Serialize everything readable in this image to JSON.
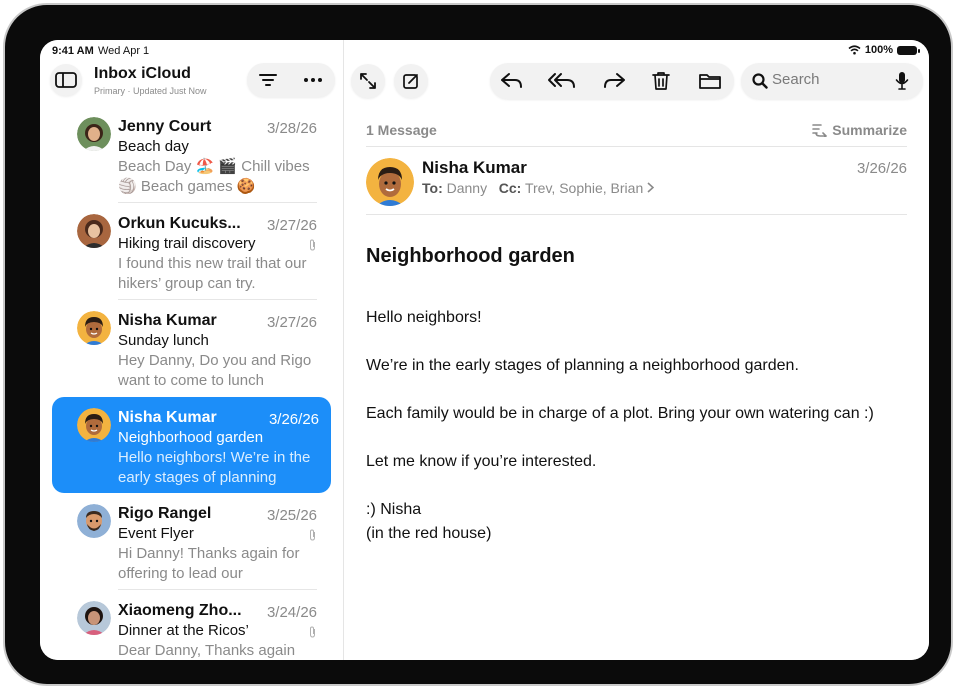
{
  "status": {
    "time": "9:41 AM",
    "date": "Wed Apr 1",
    "battery": "100%"
  },
  "mailbox": {
    "title": "Inbox iCloud",
    "subtitle": "Primary · Updated Just Now"
  },
  "toolbar": {
    "search_placeholder": "Search"
  },
  "messages": [
    {
      "sender": "Jenny Court",
      "date": "3/28/26",
      "subject": "Beach day",
      "preview": "Beach Day 🏖️ 🎬 Chill vibes 🏐 Beach games 🍪",
      "avatar": "jenny",
      "attachment": false
    },
    {
      "sender": "Orkun Kucuks...",
      "date": "3/27/26",
      "subject": "Hiking trail discovery",
      "preview": "I found this new trail that our hikers’ group can try.",
      "avatar": "orkun",
      "attachment": true
    },
    {
      "sender": "Nisha Kumar",
      "date": "3/27/26",
      "subject": "Sunday lunch",
      "preview": "Hey Danny, Do you and Rigo want to come to lunch",
      "avatar": "nisha",
      "attachment": false
    },
    {
      "sender": "Nisha Kumar",
      "date": "3/26/26",
      "subject": "Neighborhood garden",
      "preview": "Hello neighbors! We’re in the early stages of planning",
      "avatar": "nisha",
      "attachment": false,
      "selected": true
    },
    {
      "sender": "Rigo Rangel",
      "date": "3/25/26",
      "subject": "Event Flyer",
      "preview": "Hi Danny! Thanks again for offering to lead our",
      "avatar": "rigo",
      "attachment": true
    },
    {
      "sender": "Xiaomeng Zho...",
      "date": "3/24/26",
      "subject": "Dinner at the Ricos’",
      "preview": "Dear Danny, Thanks again",
      "avatar": "xiaomeng",
      "attachment": true
    }
  ],
  "detail": {
    "count_label": "1 Message",
    "summarize_label": "Summarize",
    "from": "Nisha Kumar",
    "to_label": "To:",
    "to": "Danny",
    "cc_label": "Cc:",
    "cc": "Trev, Sophie, Brian",
    "date": "3/26/26",
    "subject": "Neighborhood garden",
    "body": [
      "Hello neighbors!",
      "We’re in the early stages of planning a neighborhood garden.",
      "Each family would be in charge of a plot. Bring your own watering can :)",
      "Let me know if you’re interested.",
      ":) Nisha",
      "(in the red house)"
    ]
  },
  "colors": {
    "accent": "#1c8ef9",
    "frame": "#0b0b0b"
  }
}
